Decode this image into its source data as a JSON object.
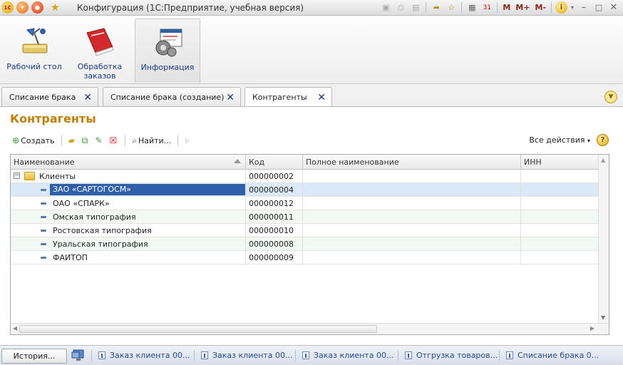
{
  "window": {
    "title": "Конфигурация  (1С:Предприятие, учебная версия)"
  },
  "title_buttons": {
    "m": "M",
    "m_plus": "M+",
    "m_minus": "M-",
    "info": "i",
    "calendar_day": "31"
  },
  "sections": [
    {
      "label": "Рабочий стол",
      "icon": "desk-lamp-icon"
    },
    {
      "label": "Обработка заказов",
      "icon": "red-book-icon"
    },
    {
      "label": "Информация",
      "icon": "gear-window-icon",
      "active": true
    }
  ],
  "tabs": [
    {
      "label": "Списание брака"
    },
    {
      "label": "Списание брака (создание)"
    },
    {
      "label": "Контрагенты",
      "active": true
    }
  ],
  "page": {
    "title": "Контрагенты"
  },
  "toolbar": {
    "create": "Создать",
    "find": "Найти...",
    "all_actions": "Все действия",
    "help": "?"
  },
  "table": {
    "columns": [
      "Наименование",
      "Код",
      "Полное наименование",
      "ИНН"
    ],
    "rows": [
      {
        "name": "Клиенты",
        "code": "000000002",
        "full": "",
        "inn": "",
        "type": "group"
      },
      {
        "name": "ЗАО «САРТОГОСМ»",
        "code": "000000004",
        "full": "",
        "inn": "",
        "type": "item",
        "selected": true
      },
      {
        "name": "ОАО «СПАРК»",
        "code": "000000012",
        "full": "",
        "inn": "",
        "type": "item"
      },
      {
        "name": "Омская типография",
        "code": "000000011",
        "full": "",
        "inn": "",
        "type": "item"
      },
      {
        "name": "Ростовская типография",
        "code": "000000010",
        "full": "",
        "inn": "",
        "type": "item"
      },
      {
        "name": "Уральская типография",
        "code": "000000008",
        "full": "",
        "inn": "",
        "type": "item"
      },
      {
        "name": "ФАИТОП",
        "code": "000000009",
        "full": "",
        "inn": "",
        "type": "item"
      }
    ]
  },
  "statusbar": {
    "history": "История...",
    "windows": [
      "Заказ клиента 00...",
      "Заказ клиента 00...",
      "Заказ клиента 00...",
      "Отгрузка товаров...",
      "Списание брака 0..."
    ]
  }
}
